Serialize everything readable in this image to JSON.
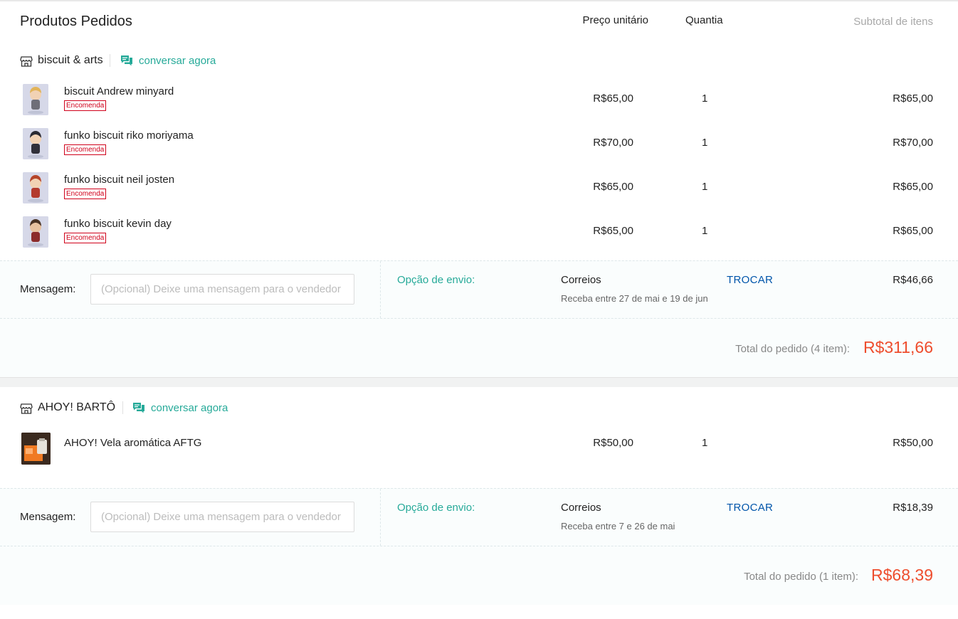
{
  "header": {
    "title": "Produtos Pedidos",
    "col_price": "Preço unitário",
    "col_qty": "Quantia",
    "col_subtotal": "Subtotal de itens"
  },
  "shops": [
    {
      "name": "biscuit & arts",
      "chat_label": "conversar agora",
      "items": [
        {
          "name": "biscuit Andrew minyard",
          "badge": "Encomenda",
          "price": "R$65,00",
          "qty": "1",
          "subtotal": "R$65,00"
        },
        {
          "name": "funko biscuit riko moriyama",
          "badge": "Encomenda",
          "price": "R$70,00",
          "qty": "1",
          "subtotal": "R$70,00"
        },
        {
          "name": "funko biscuit neil josten",
          "badge": "Encomenda",
          "price": "R$65,00",
          "qty": "1",
          "subtotal": "R$65,00"
        },
        {
          "name": "funko biscuit kevin day",
          "badge": "Encomenda",
          "price": "R$65,00",
          "qty": "1",
          "subtotal": "R$65,00"
        }
      ],
      "message_label": "Mensagem:",
      "message_placeholder": "(Opcional) Deixe uma mensagem para o vendedor",
      "shipping": {
        "label": "Opção de envio:",
        "carrier": "Correios",
        "eta": "Receba entre 27 de mai e 19 de jun",
        "change": "TROCAR",
        "cost": "R$46,66"
      },
      "total_label": "Total do pedido (4 item):",
      "total_value": "R$311,66"
    },
    {
      "name": "AHOY! BARTÔ",
      "chat_label": "conversar agora",
      "items": [
        {
          "name": "AHOY! Vela aromática AFTG",
          "price": "R$50,00",
          "qty": "1",
          "subtotal": "R$50,00"
        }
      ],
      "message_label": "Mensagem:",
      "message_placeholder": "(Opcional) Deixe uma mensagem para o vendedor",
      "shipping": {
        "label": "Opção de envio:",
        "carrier": "Correios",
        "eta": "Receba entre 7 e 26 de mai",
        "change": "TROCAR",
        "cost": "R$18,39"
      },
      "total_label": "Total do pedido (1 item):",
      "total_value": "R$68,39"
    }
  ],
  "colors": {
    "accent": "#26aa99",
    "price_red": "#ee4d2d",
    "badge_red": "#d0011b",
    "link_blue": "#0055aa"
  }
}
